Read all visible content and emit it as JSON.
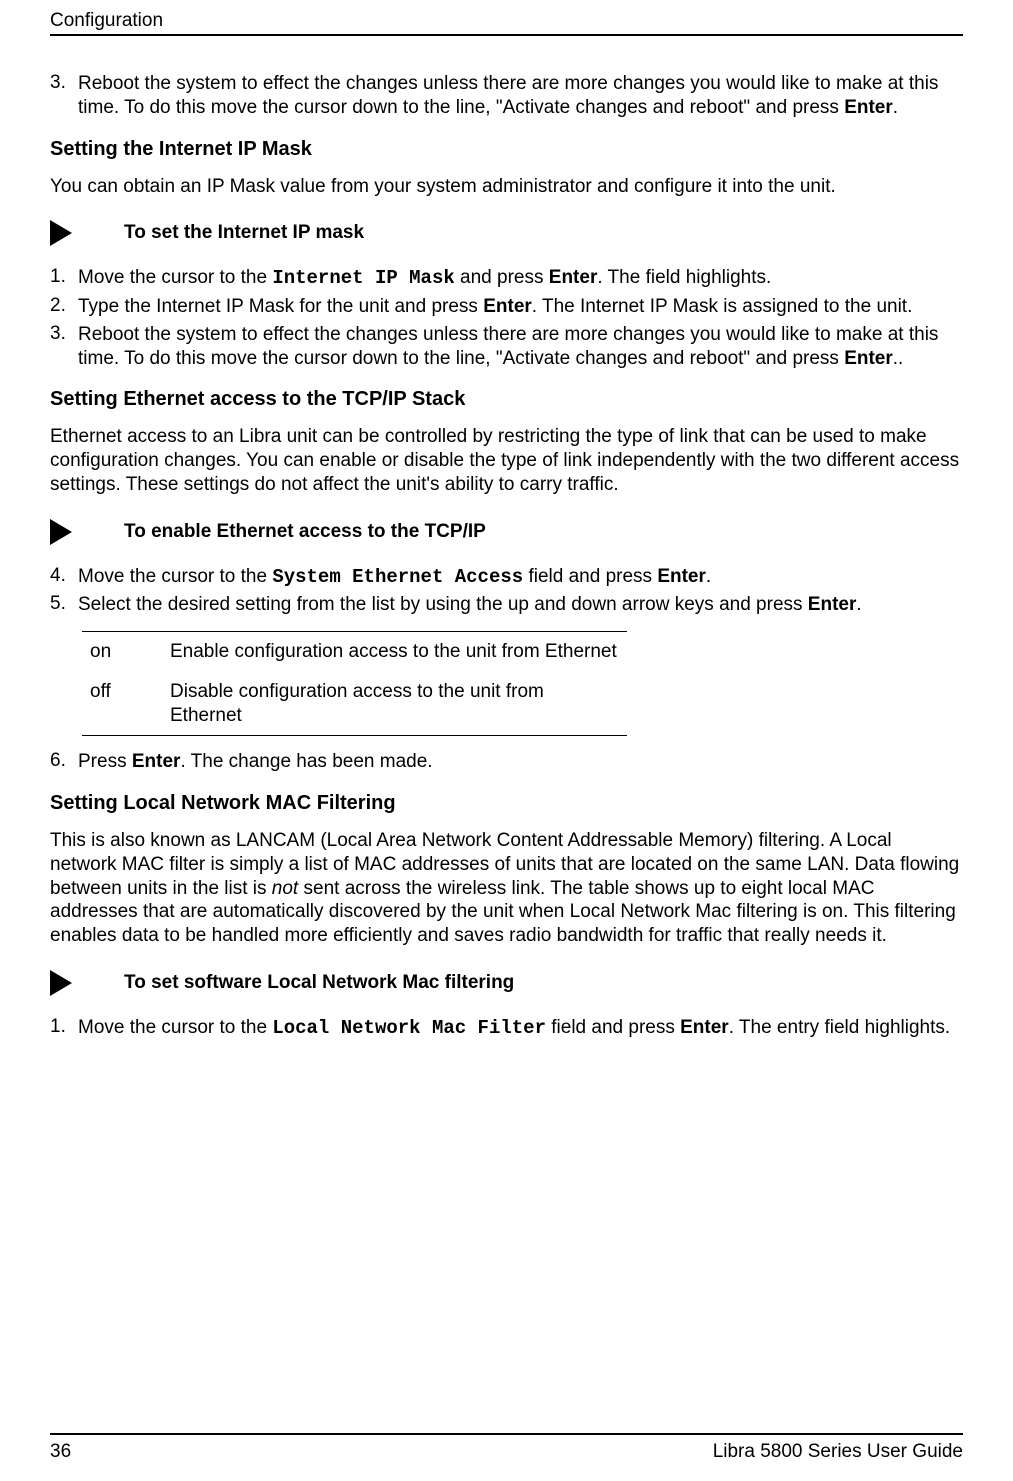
{
  "header": {
    "section": "Configuration"
  },
  "top_list": {
    "item3_num": "3.",
    "item3_a": "Reboot the system to effect the changes unless there are more changes you would like to make at this time. To do this move the cursor down to the line, \"Activate changes and reboot\" and press ",
    "item3_b": "Enter",
    "item3_c": "."
  },
  "sec1": {
    "heading": "Setting the Internet IP Mask",
    "intro": "You can obtain an IP Mask value from your system administrator and configure it into the unit.",
    "proc_label": "To set the Internet IP mask",
    "s1": {
      "num": "1.",
      "a": "Move the cursor to the ",
      "mono": "Internet IP Mask",
      "b": " and press ",
      "bold": "Enter",
      "c": ". The field highlights."
    },
    "s2": {
      "num": "2.",
      "a": "Type the Internet IP Mask for the unit and press ",
      "bold": "Enter",
      "b": ". The Internet IP Mask is assigned to the unit."
    },
    "s3": {
      "num": "3.",
      "a": "Reboot the system to effect the changes unless there are more changes you would like to make at this time. To do this move the cursor down to the line, \"Activate changes and reboot\" and press ",
      "bold": "Enter",
      "b": ".."
    }
  },
  "sec2": {
    "heading": "Setting Ethernet access to the TCP/IP Stack",
    "intro": "Ethernet access to an Libra unit can be controlled by restricting the type of link that can be used to make configuration changes. You can enable or disable the type of link independently with the two different access settings. These settings do not affect the unit's ability to carry traffic.",
    "proc_label": "To enable Ethernet access to the TCP/IP",
    "s4": {
      "num": "4.",
      "a": "Move the cursor to the ",
      "mono": "System Ethernet Access",
      "b": " field and press ",
      "bold": "Enter",
      "c": "."
    },
    "s5": {
      "num": "5.",
      "a": "Select the desired setting from the list by using the up and down arrow keys and press ",
      "bold": "Enter",
      "b": "."
    },
    "table": {
      "r1k": "on",
      "r1v": "Enable configuration access to the unit from Ethernet",
      "r2k": "off",
      "r2v": "Disable configuration access to the unit from Ethernet"
    },
    "s6": {
      "num": "6.",
      "a": "Press ",
      "bold": "Enter",
      "b": ". The change has been made."
    }
  },
  "sec3": {
    "heading": "Setting Local Network MAC Filtering",
    "intro_a": "This is also known as LANCAM (Local Area Network Content Addressable Memory) filtering. A Local network MAC filter is simply a list of MAC addresses of units that are located on the same LAN. Data flowing between units in the list is ",
    "intro_i": "not",
    "intro_b": " sent across the wireless link. The table shows up to eight local MAC addresses that are automatically discovered by the unit when Local Network Mac filtering is on. This filtering enables data to be handled more efficiently and saves radio bandwidth for traffic that really needs it.",
    "proc_label": "To set software Local Network Mac filtering",
    "s1": {
      "num": "1.",
      "a": "Move the cursor to the ",
      "mono": "Local Network Mac Filter",
      "b": " field and press ",
      "bold": "Enter",
      "c": ". The entry field highlights."
    }
  },
  "footer": {
    "page": "36",
    "title": "Libra 5800 Series User Guide"
  }
}
